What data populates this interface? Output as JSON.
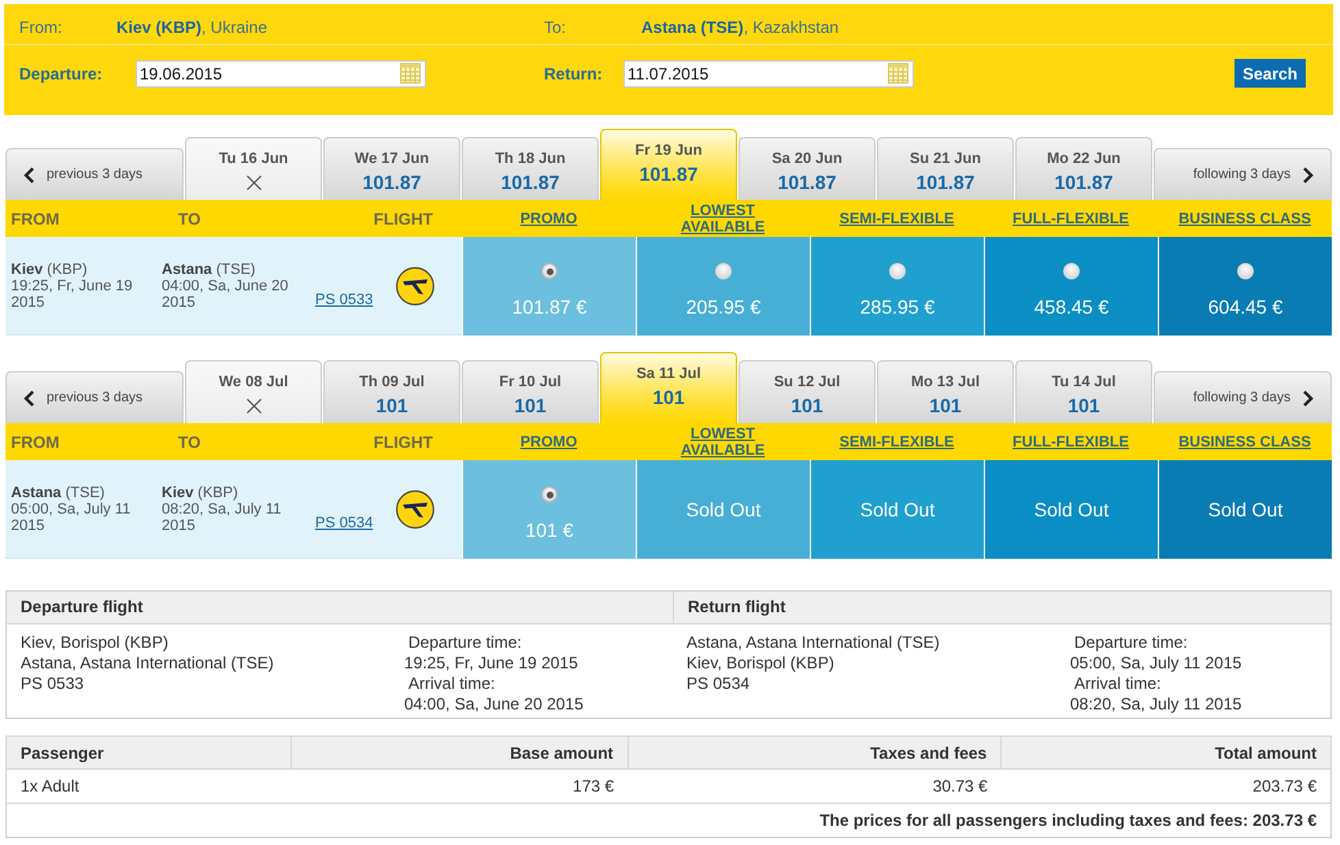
{
  "search_form": {
    "from": {
      "label": "From:",
      "value": "**Kiev (KBP)**, Ukraine"
    },
    "to": {
      "label": "To:",
      "value": "**Astana (TSE)**, Kazakhstan"
    },
    "departure": {
      "label": "Departure:",
      "value": "19.06.2015"
    },
    "return": {
      "label": "Return:",
      "value": "11.07.2015"
    },
    "search_button": "Search"
  },
  "journeys": [
    {
      "previous": "previous 3 days",
      "following": "following 3 days",
      "dates": [
        {
          "label": "Tu 16 Jun",
          "available": false,
          "selected": false
        },
        {
          "label": "We 17 Jun",
          "price": "101.87",
          "available": true,
          "selected": false
        },
        {
          "label": "Th 18 Jun",
          "price": "101.87",
          "available": true,
          "selected": false
        },
        {
          "label": "Fr 19 Jun",
          "price": "101.87",
          "available": true,
          "selected": true
        },
        {
          "label": "Sa 20 Jun",
          "price": "101.87",
          "available": true,
          "selected": false
        },
        {
          "label": "Su 21 Jun",
          "price": "101.87",
          "available": true,
          "selected": false
        },
        {
          "label": "Mo 22 Jun",
          "price": "101.87",
          "available": true,
          "selected": false
        }
      ],
      "columns": [
        "FROM",
        "TO",
        "FLIGHT"
      ],
      "fare_classes": [
        "PROMO",
        "LOWEST AVAILABLE",
        "SEMI-FLEXIBLE",
        "FULL-FLEXIBLE",
        "BUSINESS CLASS"
      ],
      "flight": {
        "departure_airport": "**Kiev** (KBP)",
        "departure_time": "19:25, Fr, June 19 2015",
        "arrival_airport": "**Astana** (TSE)",
        "arrival_time": "04:00, Sa, June 20 2015",
        "number": "PS 0533"
      },
      "fares": [
        {
          "kind": "price",
          "price": "101.87 €",
          "selected": true
        },
        {
          "kind": "price",
          "price": "205.95 €",
          "selected": false
        },
        {
          "kind": "price",
          "price": "285.95 €",
          "selected": false
        },
        {
          "kind": "price",
          "price": "458.45 €",
          "selected": false
        },
        {
          "kind": "price",
          "price": "604.45 €",
          "selected": false
        }
      ]
    },
    {
      "previous": "previous 3 days",
      "following": "following 3 days",
      "dates": [
        {
          "label": "We 08 Jul",
          "available": false,
          "selected": false
        },
        {
          "label": "Th 09 Jul",
          "price": "101",
          "available": true,
          "selected": false
        },
        {
          "label": "Fr 10 Jul",
          "price": "101",
          "available": true,
          "selected": false
        },
        {
          "label": "Sa 11 Jul",
          "price": "101",
          "available": true,
          "selected": true
        },
        {
          "label": "Su 12 Jul",
          "price": "101",
          "available": true,
          "selected": false
        },
        {
          "label": "Mo 13 Jul",
          "price": "101",
          "available": true,
          "selected": false
        },
        {
          "label": "Tu 14 Jul",
          "price": "101",
          "available": true,
          "selected": false
        }
      ],
      "columns": [
        "FROM",
        "TO",
        "FLIGHT"
      ],
      "fare_classes": [
        "PROMO",
        "LOWEST AVAILABLE",
        "SEMI-FLEXIBLE",
        "FULL-FLEXIBLE",
        "BUSINESS CLASS"
      ],
      "flight": {
        "departure_airport": "**Astana** (TSE)",
        "departure_time": "05:00, Sa, July 11 2015",
        "arrival_airport": "**Kiev** (KBP)",
        "arrival_time": "08:20, Sa, July 11 2015",
        "number": "PS 0534"
      },
      "fares": [
        {
          "kind": "price",
          "price": "101 €",
          "selected": true
        },
        {
          "kind": "sold_out",
          "label": "Sold Out"
        },
        {
          "kind": "sold_out",
          "label": "Sold Out"
        },
        {
          "kind": "sold_out",
          "label": "Sold Out"
        },
        {
          "kind": "sold_out",
          "label": "Sold Out"
        }
      ]
    }
  ],
  "summary": {
    "sections": [
      {
        "title": "Departure flight",
        "route": [
          "Kiev, Borispol (KBP)",
          "Astana, Astana International (TSE)",
          "PS 0533"
        ],
        "times": [
          {
            "label": "Departure time:",
            "value": "19:25, Fr, June 19 2015"
          },
          {
            "label": "Arrival time:",
            "value": "04:00, Sa, June 20 2015"
          }
        ]
      },
      {
        "title": "Return flight",
        "route": [
          "Astana, Astana International (TSE)",
          "Kiev, Borispol (KBP)",
          "PS 0534"
        ],
        "times": [
          {
            "label": "Departure time:",
            "value": "05:00, Sa, July 11 2015"
          },
          {
            "label": "Arrival time:",
            "value": "08:20, Sa, July 11 2015"
          }
        ]
      }
    ]
  },
  "prices": {
    "columns": [
      "Passenger",
      "Base amount",
      "Taxes and fees",
      "Total amount"
    ],
    "rows": [
      [
        "1x Adult",
        "173 €",
        "30.73 €",
        "203.73 €"
      ]
    ],
    "total": "The prices for all passengers including taxes and fees: 203.73 €"
  }
}
